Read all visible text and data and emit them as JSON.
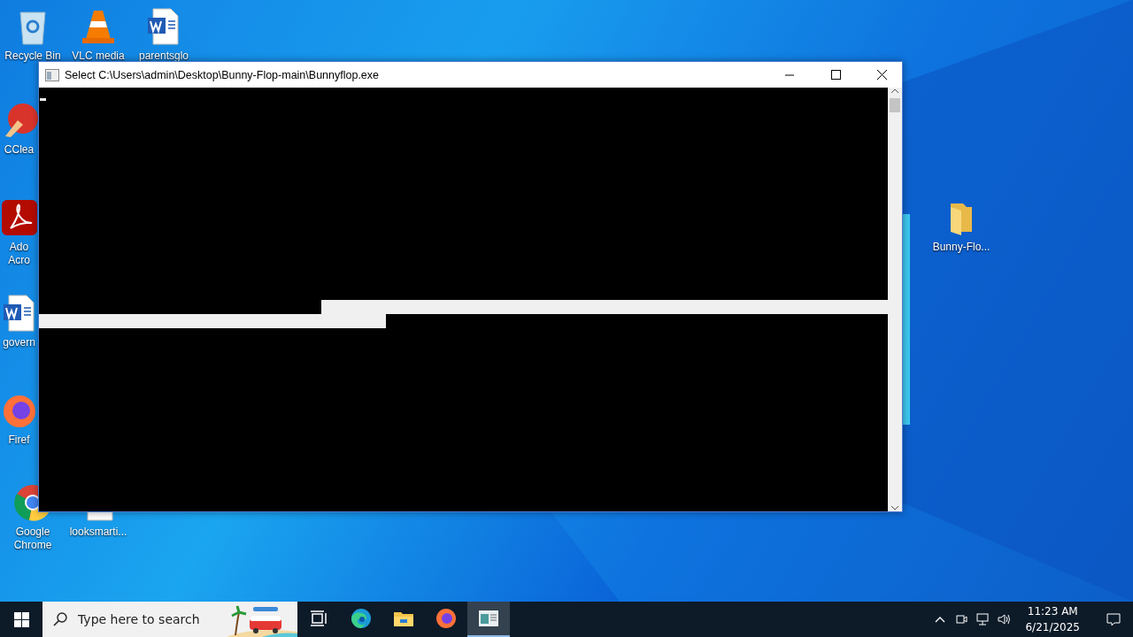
{
  "desktop_icons": [
    {
      "kind": "recycle",
      "lines": [
        "Recycle Bin"
      ]
    },
    {
      "kind": "vlc",
      "lines": [
        "VLC media"
      ]
    },
    {
      "kind": "word",
      "lines": [
        "parentsglo"
      ]
    },
    {
      "kind": "ccleaner",
      "lines": [
        "CClea"
      ]
    },
    {
      "kind": "acrobat",
      "lines": [
        "Ado",
        "Acro"
      ]
    },
    {
      "kind": "word",
      "lines": [
        "govern"
      ]
    },
    {
      "kind": "firefox",
      "lines": [
        "Firef"
      ]
    },
    {
      "kind": "chrome",
      "lines": [
        "Google",
        "Chrome"
      ]
    },
    {
      "kind": "document",
      "lines": [
        "looksmarti..."
      ]
    },
    {
      "kind": "folder",
      "lines": [
        "Bunny-Flo..."
      ]
    }
  ],
  "console_window": {
    "title": "Select C:\\Users\\admin\\Desktop\\Bunny-Flop-main\\Bunnyflop.exe"
  },
  "taskbar": {
    "search": {
      "placeholder": "Type here to search"
    },
    "apps": [
      {
        "kind": "taskview",
        "selected": false
      },
      {
        "kind": "edge",
        "selected": false
      },
      {
        "kind": "explorer",
        "selected": false
      },
      {
        "kind": "firefox",
        "selected": false
      },
      {
        "kind": "console",
        "selected": true
      }
    ],
    "clock": {
      "time": "11:23 AM",
      "date": "6/21/2025"
    }
  }
}
